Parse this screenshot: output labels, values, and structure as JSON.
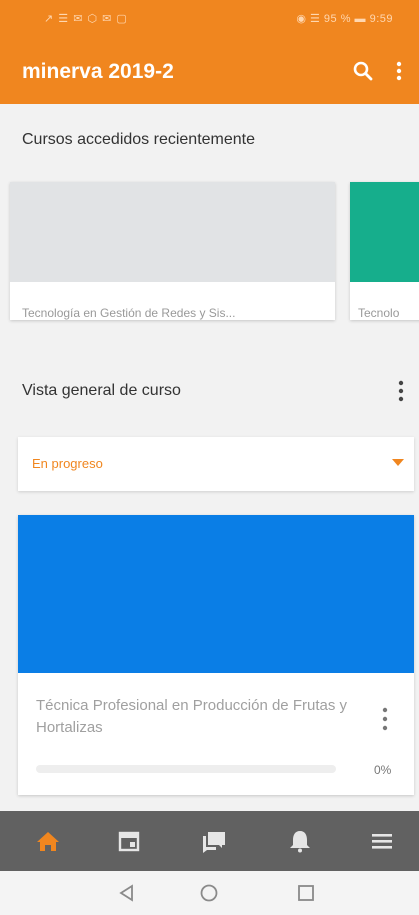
{
  "status_bar": {
    "left": "↗ ☰ ✉ ⬡ ✉ ▢",
    "right": "◉ ☰ 95 % ▬ 9:59"
  },
  "app_bar": {
    "title": "minerva 2019-2",
    "actions": [
      "search-icon",
      "more-vertical-icon"
    ]
  },
  "recent": {
    "heading": "Cursos accedidos recientemente",
    "courses": [
      {
        "name": "Tecnología en Gestión de Redes y Sis...",
        "color": "#e1e3e5"
      },
      {
        "name": "Tecnolo",
        "color": "#16ae8c"
      }
    ]
  },
  "overview": {
    "heading": "Vista general de curso",
    "filter_value": "En progreso",
    "course": {
      "name": "Técnica Profesional en Producción de Frutas y Hortalizas",
      "color": "#0a7ee6",
      "progress_percent": 0,
      "progress_label": "0%"
    }
  },
  "bottom_nav": {
    "items": [
      "home-icon",
      "calendar-icon",
      "messages-icon",
      "notifications-icon",
      "menu-icon"
    ],
    "active_color": "#f0861f",
    "inactive_color": "#e6e6e6"
  },
  "system_nav": [
    "back-icon",
    "home-circle-icon",
    "recents-icon"
  ]
}
